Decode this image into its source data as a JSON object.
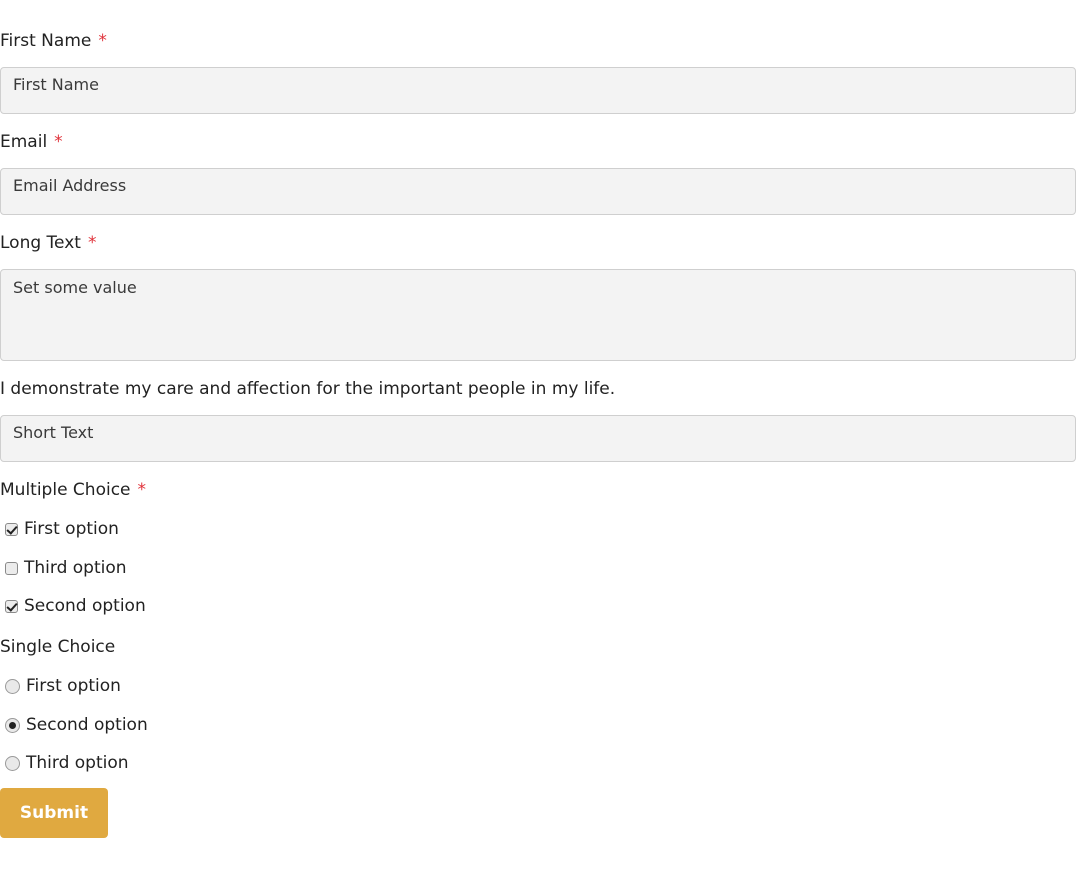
{
  "form": {
    "first_name": {
      "label": "First Name",
      "required_mark": "*",
      "placeholder": "First Name"
    },
    "email": {
      "label": "Email",
      "required_mark": "*",
      "placeholder": "Email Address"
    },
    "long_text": {
      "label": "Long Text",
      "required_mark": "*",
      "placeholder": "Set some value"
    },
    "statement": {
      "label": "I demonstrate my care and affection for the important people in my life.",
      "placeholder": "Short Text"
    },
    "multiple_choice": {
      "label": "Multiple Choice",
      "required_mark": "*",
      "options": [
        {
          "label": "First option",
          "checked": true
        },
        {
          "label": "Third option",
          "checked": false
        },
        {
          "label": "Second option",
          "checked": true
        }
      ]
    },
    "single_choice": {
      "label": "Single Choice",
      "options": [
        {
          "label": "First option",
          "selected": false
        },
        {
          "label": "Second option",
          "selected": true
        },
        {
          "label": "Third option",
          "selected": false
        }
      ]
    },
    "submit_label": "Submit"
  },
  "colors": {
    "accent": "#e0a940",
    "required": "#e0323a",
    "field_bg": "#f3f3f3"
  }
}
